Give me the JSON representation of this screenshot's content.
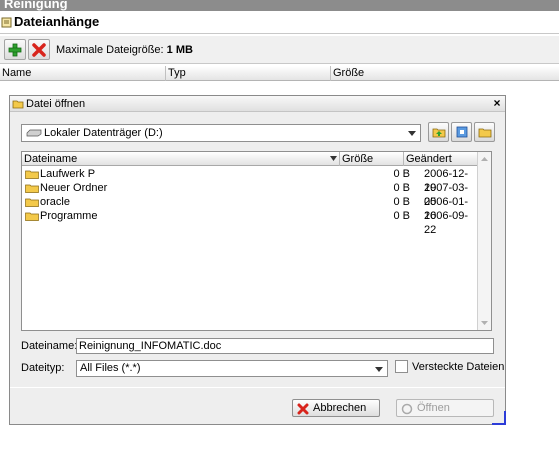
{
  "app": {
    "title": "Reinigung"
  },
  "attachments": {
    "title": "Dateianhänge",
    "max_size_label": "Maximale Dateigröße:",
    "max_size_value": "1 MB",
    "columns": [
      "Name",
      "Typ",
      "Größe"
    ]
  },
  "dialog": {
    "title": "Datei öffnen",
    "look_in": "Lokaler Datenträger (D:)",
    "list_headers": {
      "name": "Dateiname",
      "size": "Größe",
      "modified": "Geändert"
    },
    "files": [
      {
        "name": "Laufwerk P",
        "size": "0 B",
        "modified": "2006-12-19"
      },
      {
        "name": "Neuer Ordner",
        "size": "0 B",
        "modified": "2007-03-05"
      },
      {
        "name": "oracle",
        "size": "0 B",
        "modified": "2006-01-16"
      },
      {
        "name": "Programme",
        "size": "0 B",
        "modified": "2006-09-22"
      }
    ],
    "filename_label": "Dateiname:",
    "filename_value": "Reinignung_INFOMATIC.doc",
    "filetype_label": "Dateityp:",
    "filetype_value": "All Files (*.*)",
    "hidden_files_label": "Versteckte Dateien",
    "cancel_label": "Abbrechen",
    "open_label": "Öffnen"
  },
  "colors": {
    "add": "#2fa12f",
    "remove": "#d8241c",
    "folder": "#f3c94a",
    "accent_corner": "#2c3cd8"
  }
}
